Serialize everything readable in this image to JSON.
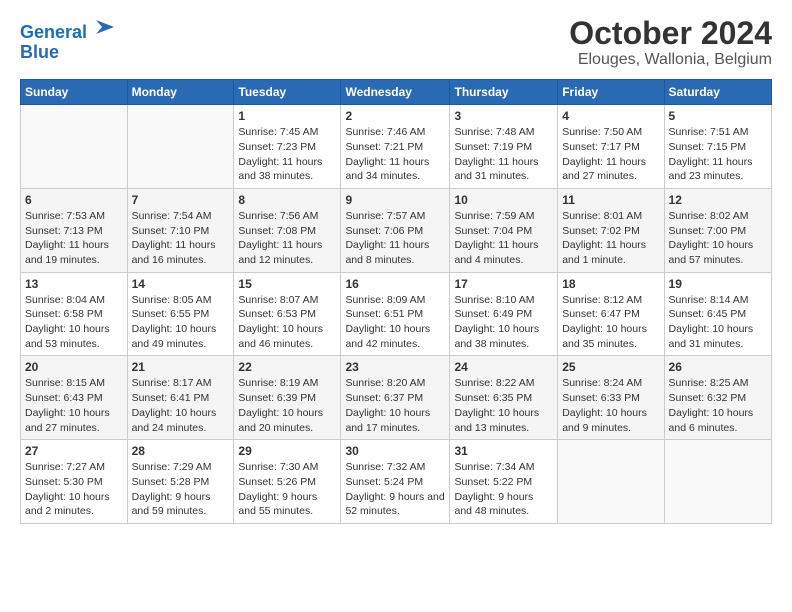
{
  "header": {
    "logo_line1": "General",
    "logo_line2": "Blue",
    "title": "October 2024",
    "subtitle": "Elouges, Wallonia, Belgium"
  },
  "days_of_week": [
    "Sunday",
    "Monday",
    "Tuesday",
    "Wednesday",
    "Thursday",
    "Friday",
    "Saturday"
  ],
  "weeks": [
    [
      {
        "day": "",
        "info": ""
      },
      {
        "day": "",
        "info": ""
      },
      {
        "day": "1",
        "info": "Sunrise: 7:45 AM\nSunset: 7:23 PM\nDaylight: 11 hours and 38 minutes."
      },
      {
        "day": "2",
        "info": "Sunrise: 7:46 AM\nSunset: 7:21 PM\nDaylight: 11 hours and 34 minutes."
      },
      {
        "day": "3",
        "info": "Sunrise: 7:48 AM\nSunset: 7:19 PM\nDaylight: 11 hours and 31 minutes."
      },
      {
        "day": "4",
        "info": "Sunrise: 7:50 AM\nSunset: 7:17 PM\nDaylight: 11 hours and 27 minutes."
      },
      {
        "day": "5",
        "info": "Sunrise: 7:51 AM\nSunset: 7:15 PM\nDaylight: 11 hours and 23 minutes."
      }
    ],
    [
      {
        "day": "6",
        "info": "Sunrise: 7:53 AM\nSunset: 7:13 PM\nDaylight: 11 hours and 19 minutes."
      },
      {
        "day": "7",
        "info": "Sunrise: 7:54 AM\nSunset: 7:10 PM\nDaylight: 11 hours and 16 minutes."
      },
      {
        "day": "8",
        "info": "Sunrise: 7:56 AM\nSunset: 7:08 PM\nDaylight: 11 hours and 12 minutes."
      },
      {
        "day": "9",
        "info": "Sunrise: 7:57 AM\nSunset: 7:06 PM\nDaylight: 11 hours and 8 minutes."
      },
      {
        "day": "10",
        "info": "Sunrise: 7:59 AM\nSunset: 7:04 PM\nDaylight: 11 hours and 4 minutes."
      },
      {
        "day": "11",
        "info": "Sunrise: 8:01 AM\nSunset: 7:02 PM\nDaylight: 11 hours and 1 minute."
      },
      {
        "day": "12",
        "info": "Sunrise: 8:02 AM\nSunset: 7:00 PM\nDaylight: 10 hours and 57 minutes."
      }
    ],
    [
      {
        "day": "13",
        "info": "Sunrise: 8:04 AM\nSunset: 6:58 PM\nDaylight: 10 hours and 53 minutes."
      },
      {
        "day": "14",
        "info": "Sunrise: 8:05 AM\nSunset: 6:55 PM\nDaylight: 10 hours and 49 minutes."
      },
      {
        "day": "15",
        "info": "Sunrise: 8:07 AM\nSunset: 6:53 PM\nDaylight: 10 hours and 46 minutes."
      },
      {
        "day": "16",
        "info": "Sunrise: 8:09 AM\nSunset: 6:51 PM\nDaylight: 10 hours and 42 minutes."
      },
      {
        "day": "17",
        "info": "Sunrise: 8:10 AM\nSunset: 6:49 PM\nDaylight: 10 hours and 38 minutes."
      },
      {
        "day": "18",
        "info": "Sunrise: 8:12 AM\nSunset: 6:47 PM\nDaylight: 10 hours and 35 minutes."
      },
      {
        "day": "19",
        "info": "Sunrise: 8:14 AM\nSunset: 6:45 PM\nDaylight: 10 hours and 31 minutes."
      }
    ],
    [
      {
        "day": "20",
        "info": "Sunrise: 8:15 AM\nSunset: 6:43 PM\nDaylight: 10 hours and 27 minutes."
      },
      {
        "day": "21",
        "info": "Sunrise: 8:17 AM\nSunset: 6:41 PM\nDaylight: 10 hours and 24 minutes."
      },
      {
        "day": "22",
        "info": "Sunrise: 8:19 AM\nSunset: 6:39 PM\nDaylight: 10 hours and 20 minutes."
      },
      {
        "day": "23",
        "info": "Sunrise: 8:20 AM\nSunset: 6:37 PM\nDaylight: 10 hours and 17 minutes."
      },
      {
        "day": "24",
        "info": "Sunrise: 8:22 AM\nSunset: 6:35 PM\nDaylight: 10 hours and 13 minutes."
      },
      {
        "day": "25",
        "info": "Sunrise: 8:24 AM\nSunset: 6:33 PM\nDaylight: 10 hours and 9 minutes."
      },
      {
        "day": "26",
        "info": "Sunrise: 8:25 AM\nSunset: 6:32 PM\nDaylight: 10 hours and 6 minutes."
      }
    ],
    [
      {
        "day": "27",
        "info": "Sunrise: 7:27 AM\nSunset: 5:30 PM\nDaylight: 10 hours and 2 minutes."
      },
      {
        "day": "28",
        "info": "Sunrise: 7:29 AM\nSunset: 5:28 PM\nDaylight: 9 hours and 59 minutes."
      },
      {
        "day": "29",
        "info": "Sunrise: 7:30 AM\nSunset: 5:26 PM\nDaylight: 9 hours and 55 minutes."
      },
      {
        "day": "30",
        "info": "Sunrise: 7:32 AM\nSunset: 5:24 PM\nDaylight: 9 hours and 52 minutes."
      },
      {
        "day": "31",
        "info": "Sunrise: 7:34 AM\nSunset: 5:22 PM\nDaylight: 9 hours and 48 minutes."
      },
      {
        "day": "",
        "info": ""
      },
      {
        "day": "",
        "info": ""
      }
    ]
  ]
}
